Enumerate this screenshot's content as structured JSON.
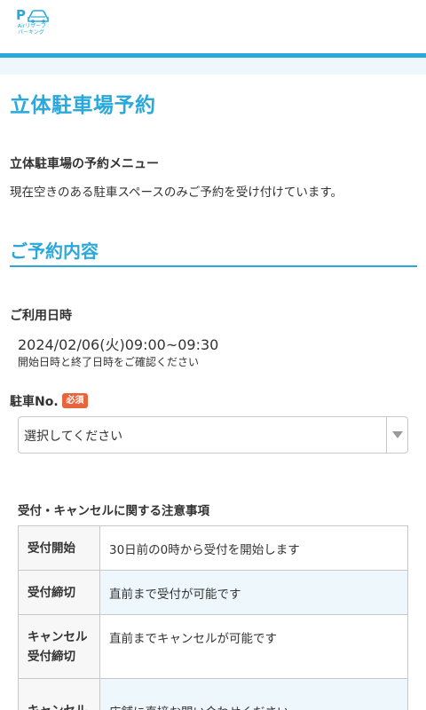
{
  "header": {
    "logo_letter": "P",
    "logo_line1": "Airリザーブ",
    "logo_line2": "パーキング",
    "accent_color": "#29a8dc"
  },
  "page": {
    "title": "立体駐車場予約",
    "menu_title": "立体駐車場の予約メニュー",
    "menu_description": "現在空きのある駐車スペースのみご予約を受け付けています。"
  },
  "section": {
    "title": "ご予約内容"
  },
  "reservation": {
    "date_label": "ご利用日時",
    "date_value": "2024/02/06(火)09:00~09:30",
    "date_note": "開始日時と終了日時をご確認ください"
  },
  "parking": {
    "label": "駐車No.",
    "required_badge": "必須",
    "select_value": "選択してください"
  },
  "notes": {
    "title": "受付・キャンセルに関する注意事項",
    "rows": [
      {
        "label": "受付開始",
        "value": "30日前の0時から受付を開始します"
      },
      {
        "label": "受付締切",
        "value": "直前まで受付が可能です"
      },
      {
        "label": "キャンセル\n受付締切",
        "value": "直前までキャンセルが可能です"
      },
      {
        "label": "キャンセル",
        "value": "店舗に直接お問い合わせください"
      }
    ]
  }
}
